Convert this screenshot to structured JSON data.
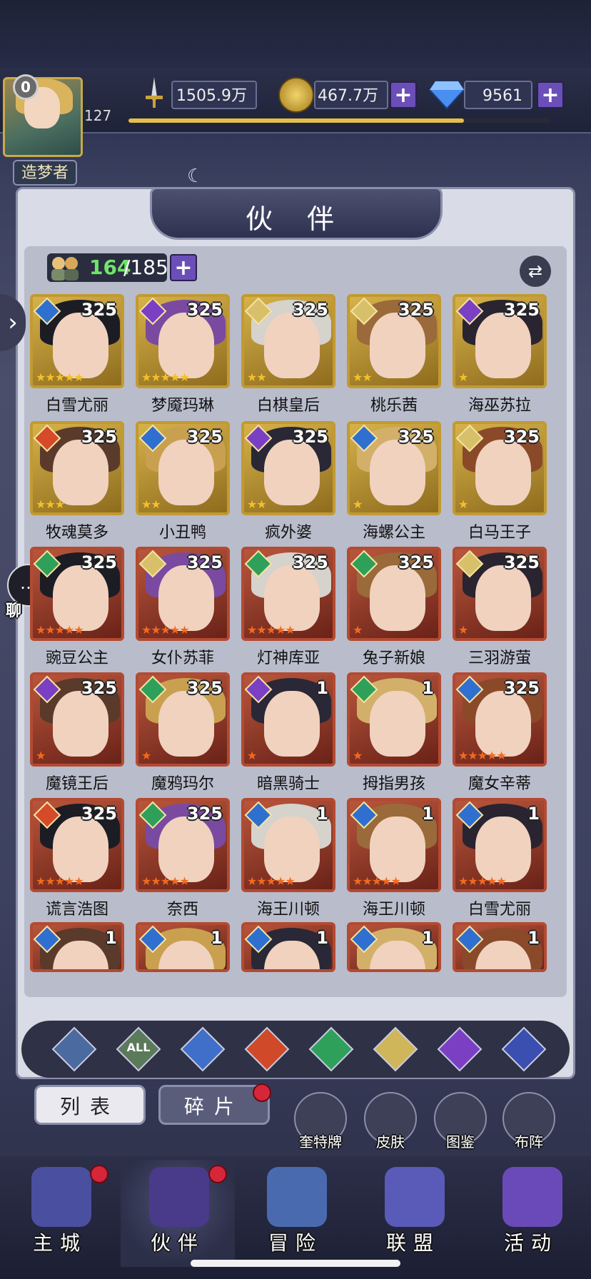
{
  "player": {
    "vip": "0",
    "level": "127",
    "title": "造梦者"
  },
  "resources": {
    "power": "1505.9万",
    "gold": "467.7万",
    "gems": "9561"
  },
  "panel": {
    "title": "伙 伴",
    "count_owned": "164",
    "count_total": "/185"
  },
  "side_chat": {
    "label": "聊 天"
  },
  "heroes": [
    {
      "name": "白雪尤丽",
      "level": "325",
      "stars": 5,
      "element": "water",
      "frame": "gold"
    },
    {
      "name": "梦魇玛琳",
      "level": "325",
      "stars": 5,
      "element": "dark",
      "frame": "gold"
    },
    {
      "name": "白棋皇后",
      "level": "325",
      "stars": 2,
      "element": "light",
      "frame": "gold"
    },
    {
      "name": "桃乐茜",
      "level": "325",
      "stars": 2,
      "element": "light",
      "frame": "gold"
    },
    {
      "name": "海巫苏拉",
      "level": "325",
      "stars": 1,
      "element": "dark",
      "frame": "gold"
    },
    {
      "name": "牧魂莫多",
      "level": "325",
      "stars": 3,
      "element": "fire",
      "frame": "gold"
    },
    {
      "name": "小丑鸭",
      "level": "325",
      "stars": 2,
      "element": "water",
      "frame": "gold"
    },
    {
      "name": "疯外婆",
      "level": "325",
      "stars": 2,
      "element": "dark",
      "frame": "gold"
    },
    {
      "name": "海螺公主",
      "level": "325",
      "stars": 1,
      "element": "water",
      "frame": "gold"
    },
    {
      "name": "白马王子",
      "level": "325",
      "stars": 1,
      "element": "light",
      "frame": "gold"
    },
    {
      "name": "豌豆公主",
      "level": "325",
      "stars": 5,
      "element": "wind",
      "frame": "red"
    },
    {
      "name": "女仆苏菲",
      "level": "325",
      "stars": 5,
      "element": "light",
      "frame": "red"
    },
    {
      "name": "灯神库亚",
      "level": "325",
      "stars": 5,
      "element": "wind",
      "frame": "red"
    },
    {
      "name": "兔子新娘",
      "level": "325",
      "stars": 1,
      "element": "wind",
      "frame": "red"
    },
    {
      "name": "三羽游萤",
      "level": "325",
      "stars": 1,
      "element": "light",
      "frame": "red"
    },
    {
      "name": "魔镜王后",
      "level": "325",
      "stars": 1,
      "element": "dark",
      "frame": "red"
    },
    {
      "name": "魔鸦玛尔",
      "level": "325",
      "stars": 1,
      "element": "wind",
      "frame": "red"
    },
    {
      "name": "暗黑骑士",
      "level": "1",
      "stars": 1,
      "element": "dark",
      "frame": "red"
    },
    {
      "name": "拇指男孩",
      "level": "1",
      "stars": 1,
      "element": "wind",
      "frame": "red"
    },
    {
      "name": "魔女辛蒂",
      "level": "325",
      "stars": 5,
      "element": "water",
      "frame": "red"
    },
    {
      "name": "谎言浩图",
      "level": "325",
      "stars": 5,
      "element": "fire",
      "frame": "red"
    },
    {
      "name": "奈西",
      "level": "325",
      "stars": 5,
      "element": "wind",
      "frame": "red"
    },
    {
      "name": "海王川顿",
      "level": "1",
      "stars": 5,
      "element": "water",
      "frame": "red"
    },
    {
      "name": "海王川顿",
      "level": "1",
      "stars": 5,
      "element": "water",
      "frame": "red"
    },
    {
      "name": "白雪尤丽",
      "level": "1",
      "stars": 5,
      "element": "water",
      "frame": "red"
    },
    {
      "name": "",
      "level": "1",
      "stars": 0,
      "element": "water",
      "frame": "red"
    },
    {
      "name": "",
      "level": "1",
      "stars": 0,
      "element": "water",
      "frame": "red"
    },
    {
      "name": "",
      "level": "1",
      "stars": 0,
      "element": "water",
      "frame": "red"
    },
    {
      "name": "",
      "level": "1",
      "stars": 0,
      "element": "water",
      "frame": "red"
    },
    {
      "name": "",
      "level": "1",
      "stars": 0,
      "element": "water",
      "frame": "red"
    }
  ],
  "filters": [
    {
      "icon": "chevron-up-icon"
    },
    {
      "icon": "all-icon",
      "label": "ALL"
    },
    {
      "icon": "water-icon"
    },
    {
      "icon": "fire-icon"
    },
    {
      "icon": "wind-icon"
    },
    {
      "icon": "light-icon"
    },
    {
      "icon": "dark-icon"
    },
    {
      "icon": "planet-icon"
    }
  ],
  "tabs": {
    "list": "列表",
    "fragments": "碎片"
  },
  "shortcuts": [
    "奎特牌",
    "皮肤",
    "图鉴",
    "布阵"
  ],
  "nav": [
    "主城",
    "伙伴",
    "冒险",
    "联盟",
    "活动"
  ],
  "colors": {
    "accent_purple": "#6b4fb8",
    "star_gold": "#f2c02c",
    "star_orange": "#f26a1e",
    "reddot": "#d6263a"
  }
}
